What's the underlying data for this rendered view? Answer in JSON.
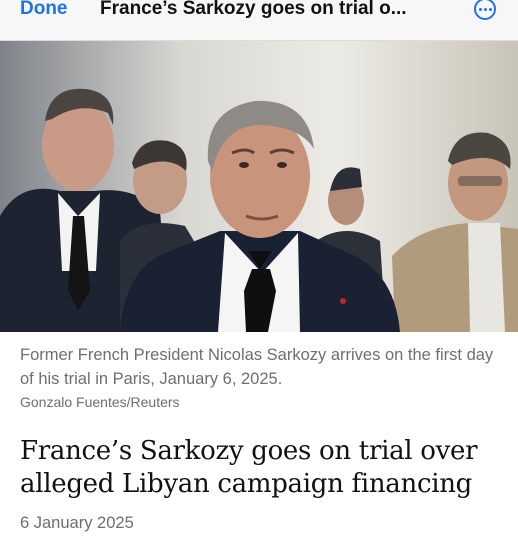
{
  "nav": {
    "done_label": "Done",
    "title": "France’s Sarkozy goes on trial o...",
    "more_icon": "ellipsis-circle-icon",
    "accent_color": "#1f72e8"
  },
  "article": {
    "image_alt": "",
    "caption": "Former French President Nicolas Sarkozy arrives on the first day of his trial in Paris, January 6, 2025.",
    "credit": "Gonzalo Fuentes/Reuters",
    "headline": "France’s Sarkozy goes on trial over alleged Libyan campaign financing",
    "date": "6 January 2025"
  }
}
